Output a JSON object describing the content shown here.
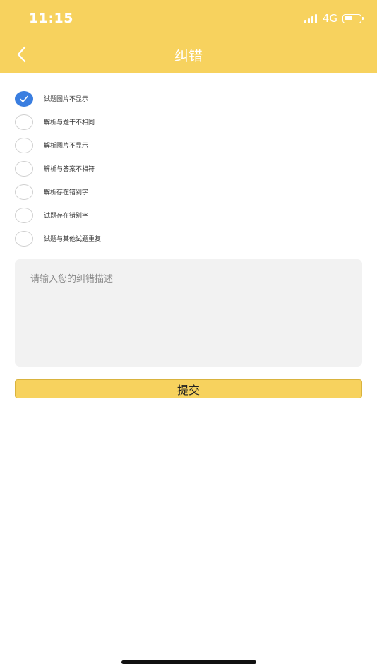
{
  "status_bar": {
    "time": "11:15",
    "network": "4G",
    "battery_level": 0.6
  },
  "nav": {
    "title": "纠错",
    "back_icon": "chevron-left-icon"
  },
  "options": [
    {
      "label": "试题图片不显示",
      "checked": true
    },
    {
      "label": "解析与题干不相同",
      "checked": false
    },
    {
      "label": "解析图片不显示",
      "checked": false
    },
    {
      "label": "解析与答案不相符",
      "checked": false
    },
    {
      "label": "解析存在错别字",
      "checked": false
    },
    {
      "label": "试题存在错别字",
      "checked": false
    },
    {
      "label": "试题与其他试题重复",
      "checked": false
    }
  ],
  "description": {
    "placeholder": "请输入您的纠错描述",
    "value": ""
  },
  "submit": {
    "label": "提交"
  },
  "colors": {
    "header": "#f7d25e",
    "checked": "#3a7ee0",
    "textarea_bg": "#f2f2f2"
  }
}
